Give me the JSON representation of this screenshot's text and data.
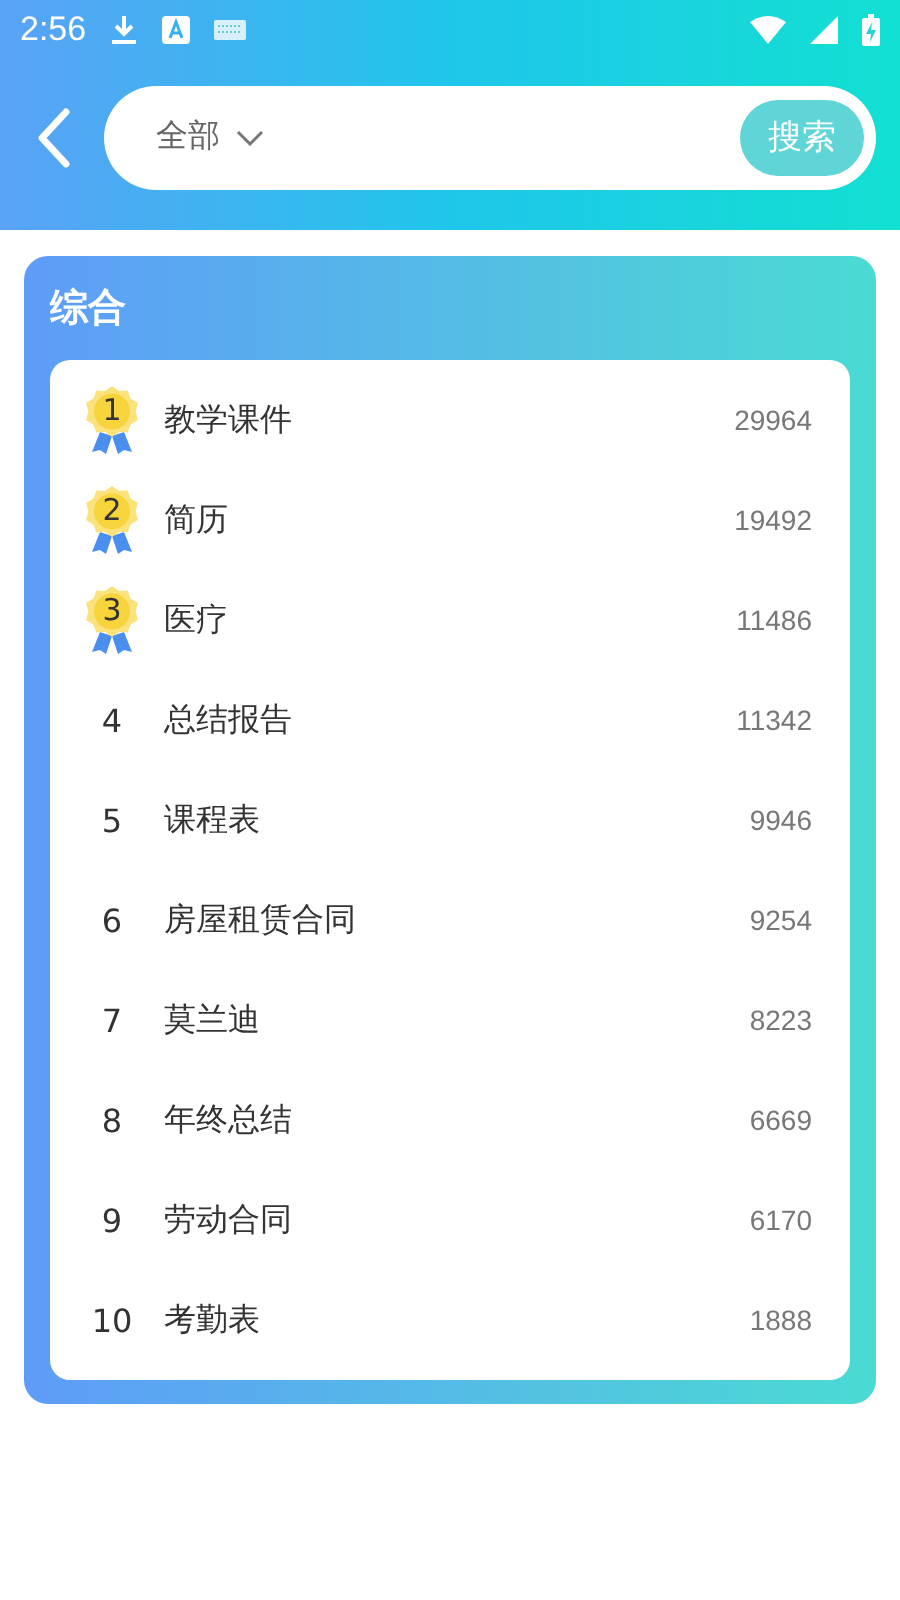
{
  "status_bar": {
    "time": "2:56"
  },
  "search": {
    "category": "全部",
    "button": "搜索"
  },
  "section": {
    "title": "综合"
  },
  "rows": [
    {
      "rank": "1",
      "kind": "medal",
      "name": "教学课件",
      "count": "29964"
    },
    {
      "rank": "2",
      "kind": "medal",
      "name": "简历",
      "count": "19492"
    },
    {
      "rank": "3",
      "kind": "medal",
      "name": "医疗",
      "count": "11486"
    },
    {
      "rank": "4",
      "kind": "plain",
      "name": "总结报告",
      "count": "11342"
    },
    {
      "rank": "5",
      "kind": "plain",
      "name": "课程表",
      "count": "9946"
    },
    {
      "rank": "6",
      "kind": "plain",
      "name": "房屋租赁合同",
      "count": "9254"
    },
    {
      "rank": "7",
      "kind": "plain",
      "name": "莫兰迪",
      "count": "8223"
    },
    {
      "rank": "8",
      "kind": "plain",
      "name": "年终总结",
      "count": "6669"
    },
    {
      "rank": "9",
      "kind": "plain",
      "name": "劳动合同",
      "count": "6170"
    },
    {
      "rank": "10",
      "kind": "plain",
      "name": "考勤表",
      "count": "1888"
    }
  ]
}
